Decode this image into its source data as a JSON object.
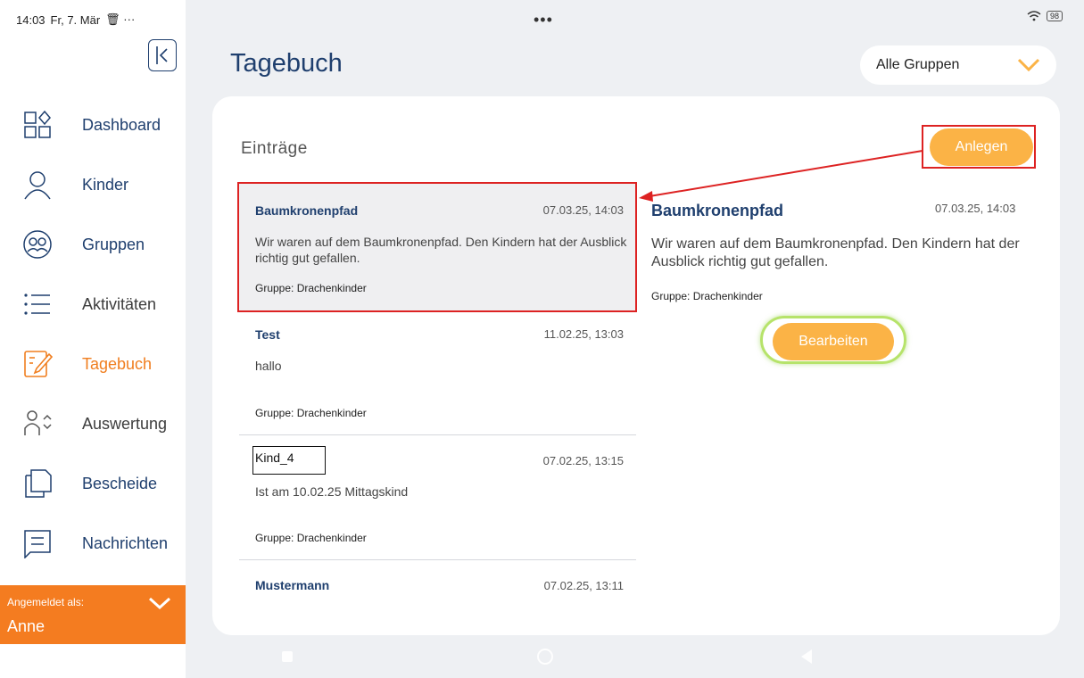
{
  "status_bar": {
    "time": "14:03",
    "date": "Fr, 7. Mär",
    "extra": "🗑 ···",
    "center_dots": "•••",
    "battery": "98"
  },
  "sidebar": {
    "items": [
      {
        "label": "Dashboard",
        "icon": "dashboard-icon"
      },
      {
        "label": "Kinder",
        "icon": "person-icon"
      },
      {
        "label": "Gruppen",
        "icon": "group-icon"
      },
      {
        "label": "Aktivitäten",
        "icon": "list-icon"
      },
      {
        "label": "Tagebuch",
        "icon": "diary-edit-icon",
        "active": true
      },
      {
        "label": "Auswertung",
        "icon": "evaluation-icon"
      },
      {
        "label": "Bescheide",
        "icon": "documents-icon"
      },
      {
        "label": "Nachrichten",
        "icon": "message-icon"
      }
    ],
    "login_caption": "Angemeldet als:",
    "login_name": "Anne"
  },
  "header": {
    "title": "Tagebuch",
    "group_filter": "Alle Gruppen"
  },
  "main": {
    "section_title": "Einträge",
    "create_button": "Anlegen",
    "entries": [
      {
        "title": "Baumkronenpfad",
        "date": "07.03.25, 14:03",
        "text": "Wir waren auf dem Baumkronenpfad. Den Kindern hat der Ausblick richtig gut gefallen.",
        "group": "Gruppe: Drachenkinder"
      },
      {
        "title": "Test",
        "date": "11.02.25, 13:03",
        "text": "hallo",
        "group": "Gruppe: Drachenkinder"
      },
      {
        "title": "Kind_4",
        "date": "07.02.25, 13:15",
        "text": "Ist am 10.02.25 Mittagskind",
        "group": "Gruppe: Drachenkinder"
      },
      {
        "title": "Mustermann",
        "date": "07.02.25, 13:11",
        "text": "",
        "group": ""
      }
    ],
    "detail": {
      "title": "Baumkronenpfad",
      "date": "07.03.25, 14:03",
      "text": "Wir waren auf dem Baumkronenpfad. Den Kindern hat der Ausblick richtig gut gefallen.",
      "group": "Gruppe: Drachenkinder",
      "edit_button": "Bearbeiten"
    }
  },
  "colors": {
    "accent": "#f47c20",
    "button": "#fbb346",
    "navy": "#1f3f6e",
    "annotation_red": "#dd2222",
    "annotation_green": "#b6e36a"
  }
}
